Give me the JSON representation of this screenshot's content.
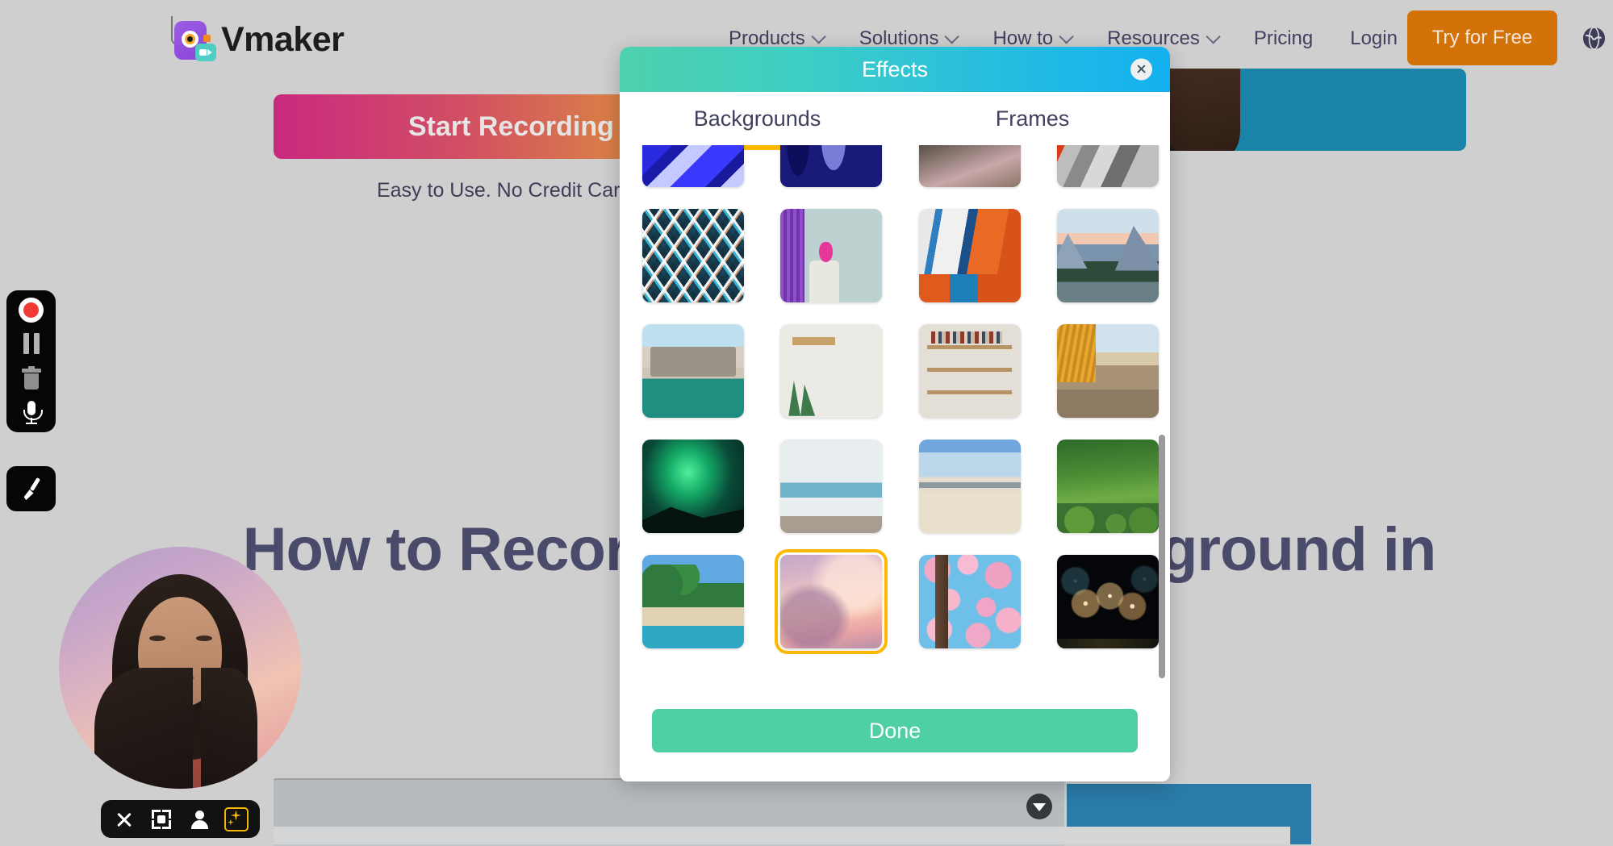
{
  "site": {
    "logo_text": "Vmaker",
    "nav_items": [
      {
        "label": "Products",
        "has_caret": true
      },
      {
        "label": "Solutions",
        "has_caret": true
      },
      {
        "label": "How to",
        "has_caret": true
      },
      {
        "label": "Resources",
        "has_caret": true
      },
      {
        "label": "Pricing",
        "has_caret": false
      },
      {
        "label": "Login",
        "has_caret": false
      }
    ],
    "cta_button": "Try for Free",
    "language_icon": "globe-icon",
    "hero_cta": "Start Recording Now",
    "hero_subtext": "Easy to Use. No Credit Card required",
    "headline": "How to Record with Virtual Background in Vmaker?"
  },
  "recorder_toolbar": {
    "buttons": [
      {
        "name": "record-button",
        "icon": "record-icon"
      },
      {
        "name": "pause-button",
        "icon": "pause-icon"
      },
      {
        "name": "delete-button",
        "icon": "trash-icon"
      },
      {
        "name": "microphone-button",
        "icon": "microphone-icon"
      }
    ],
    "brush_button": {
      "name": "annotate-button",
      "icon": "brush-icon"
    }
  },
  "webcam": {
    "controls": [
      {
        "name": "close-webcam-button",
        "icon": "close-icon"
      },
      {
        "name": "resize-webcam-button",
        "icon": "crop-icon"
      },
      {
        "name": "avatar-button",
        "icon": "person-icon"
      },
      {
        "name": "effects-button",
        "icon": "sparkle-icon",
        "active": true
      }
    ]
  },
  "modal": {
    "title": "Effects",
    "close_icon": "close-icon",
    "tabs": [
      {
        "label": "Backgrounds",
        "active": true
      },
      {
        "label": "Frames",
        "active": false
      }
    ],
    "done_label": "Done",
    "accent_color": "#fcb900",
    "done_color": "#4ecfa4",
    "header_gradient_from": "#4ed1ad",
    "header_gradient_to": "#13b0f0",
    "selected_index": 17,
    "backgrounds": [
      {
        "name": "geometric-blue-pattern",
        "class": "t-geo-blue"
      },
      {
        "name": "navy-abstract-shapes",
        "class": "t-navy-abs"
      },
      {
        "name": "dark-living-room",
        "class": "t-room1"
      },
      {
        "name": "red-metal-abstract",
        "class": "t-red-metal"
      },
      {
        "name": "triangular-glass-pattern",
        "class": "t-tri-glass"
      },
      {
        "name": "purple-wall-vase",
        "class": "t-vase"
      },
      {
        "name": "abstract-orange-painting",
        "class": "t-paint"
      },
      {
        "name": "yosemite-valley",
        "class": "t-yosemite"
      },
      {
        "name": "modern-villa-pool",
        "class": "t-pool"
      },
      {
        "name": "white-wall-shelves",
        "class": "t-shelf"
      },
      {
        "name": "bookshelf-library",
        "class": "t-books"
      },
      {
        "name": "beach-terrace-cafe",
        "class": "t-terrace"
      },
      {
        "name": "aurora-borealis",
        "class": "t-aurora"
      },
      {
        "name": "calm-seashore",
        "class": "t-seashore"
      },
      {
        "name": "sandy-beach-dunes",
        "class": "t-beach2"
      },
      {
        "name": "green-garden-path",
        "class": "t-forest"
      },
      {
        "name": "tropical-palm-beach",
        "class": "t-tropic"
      },
      {
        "name": "pink-cloud-sky",
        "class": "t-clouds"
      },
      {
        "name": "cherry-blossom",
        "class": "t-blossom"
      },
      {
        "name": "fireworks-night",
        "class": "t-fireworks"
      }
    ]
  }
}
